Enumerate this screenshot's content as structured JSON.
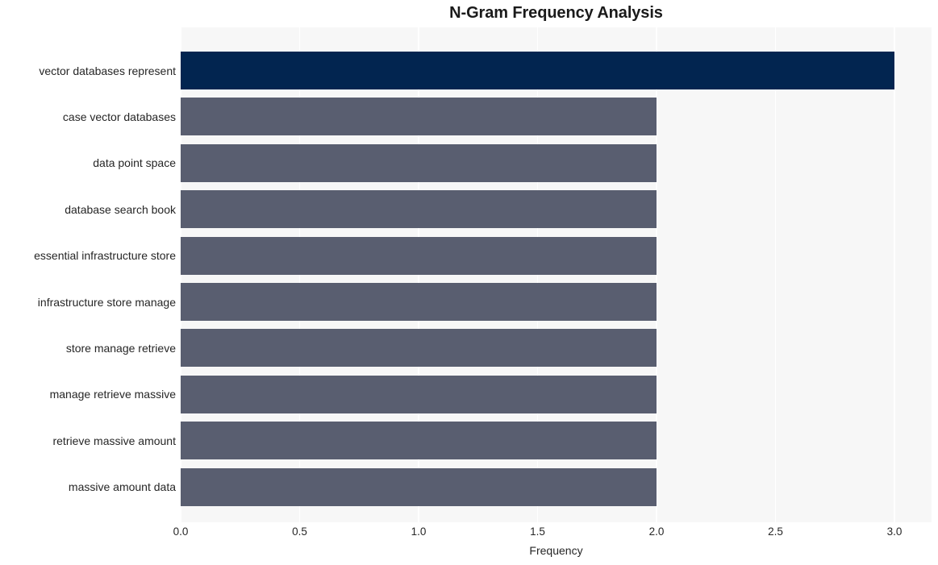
{
  "chart_data": {
    "type": "bar",
    "orientation": "horizontal",
    "title": "N-Gram Frequency Analysis",
    "xlabel": "Frequency",
    "ylabel": "",
    "xlim": [
      0.0,
      3.0
    ],
    "xticks": [
      "0.0",
      "0.5",
      "1.0",
      "1.5",
      "2.0",
      "2.5",
      "3.0"
    ],
    "xtick_values": [
      0.0,
      0.5,
      1.0,
      1.5,
      2.0,
      2.5,
      3.0
    ],
    "grid": true,
    "grid_axis": "x",
    "legend": "none",
    "categories": [
      "vector databases represent",
      "case vector databases",
      "data point space",
      "database search book",
      "essential infrastructure store",
      "infrastructure store manage",
      "store manage retrieve",
      "manage retrieve massive",
      "retrieve massive amount",
      "massive amount data"
    ],
    "values": [
      3,
      2,
      2,
      2,
      2,
      2,
      2,
      2,
      2,
      2
    ],
    "bar_colors": [
      "#022550",
      "#595e70",
      "#595e70",
      "#595e70",
      "#595e70",
      "#595e70",
      "#595e70",
      "#595e70",
      "#595e70",
      "#595e70"
    ],
    "highlight_color": "#022550",
    "base_color": "#595e70",
    "plot_background": "#f7f7f7",
    "gridline_color": "#ffffff",
    "figure_background": "#ffffff"
  }
}
